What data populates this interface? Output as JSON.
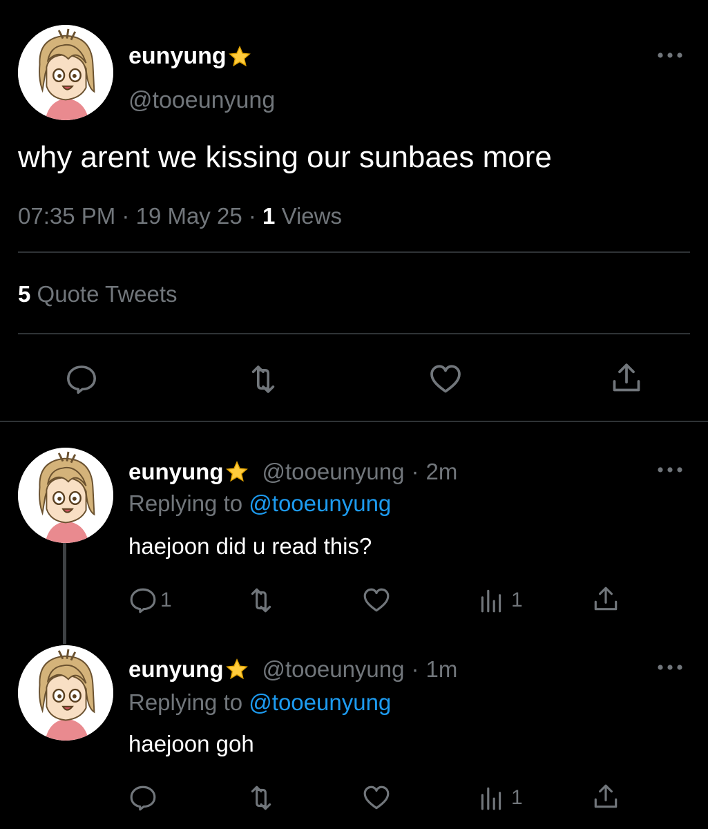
{
  "main_tweet": {
    "display_name": "eunyung",
    "handle": "@tooeunyung",
    "text": "why arent we kissing our sunbaes more",
    "time": "07:35 PM",
    "date": "19 May 25",
    "views_count": "1",
    "views_label": "Views",
    "quote_count": "5",
    "quote_label": "Quote Tweets"
  },
  "replies": [
    {
      "display_name": "eunyung",
      "handle": "@tooeunyung",
      "age": "2m",
      "replying_prefix": "Replying to",
      "replying_handle": "@tooeunyung",
      "text": "haejoon did u read this?",
      "reply_count": "1",
      "views_count": "1"
    },
    {
      "display_name": "eunyung",
      "handle": "@tooeunyung",
      "age": "1m",
      "replying_prefix": "Replying to",
      "replying_handle": "@tooeunyung",
      "text": "haejoon goh",
      "reply_count": "",
      "views_count": "1"
    }
  ],
  "separator": "·",
  "icons": {
    "star": "star-emoji-icon",
    "more": "more-icon",
    "reply": "reply-icon",
    "retweet": "retweet-icon",
    "like": "heart-icon",
    "views": "views-icon",
    "share": "share-icon"
  },
  "colors": {
    "background": "#000000",
    "text": "#e7e9ea",
    "secondary": "#71767b",
    "link": "#1d9bf0",
    "divider": "#2f3336"
  }
}
